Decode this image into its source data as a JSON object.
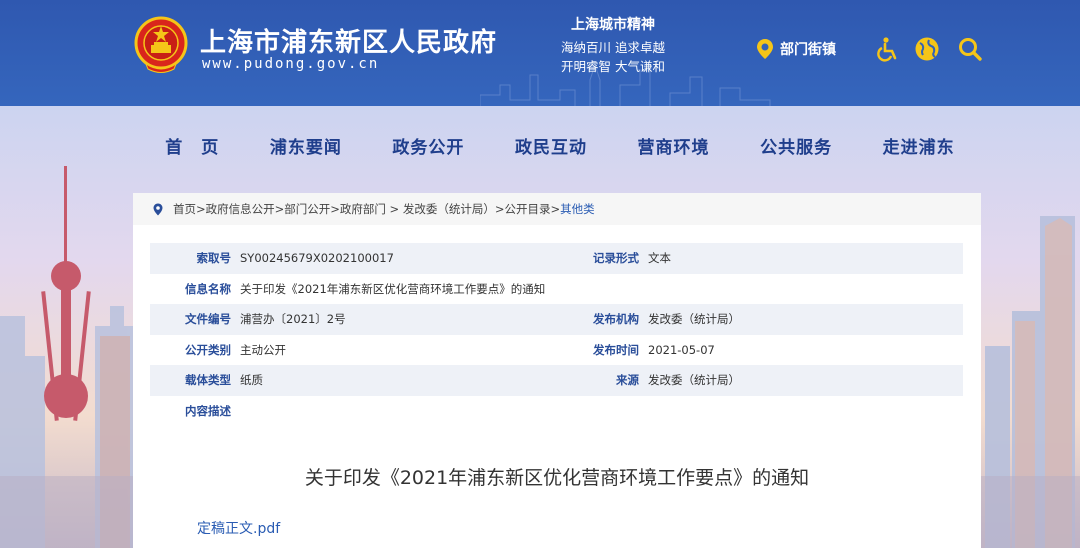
{
  "header": {
    "site_title": "上海市浦东新区人民政府",
    "site_url": "www.pudong.gov.cn",
    "spirit_title": "上海城市精神",
    "spirit_line1": "海纳百川  追求卓越",
    "spirit_line2": "开明睿智  大气谦和",
    "dept_label": "部门街镇",
    "icons": [
      "emblem",
      "location-pin-icon",
      "accessibility-icon",
      "globe-icon",
      "search-icon"
    ]
  },
  "nav": {
    "items": [
      "首　页",
      "浦东要闻",
      "政务公开",
      "政民互动",
      "营商环境",
      "公共服务",
      "走进浦东"
    ]
  },
  "breadcrumb": {
    "path": "首页>政府信息公开>部门公开>政府部门 > 发改委（统计局）>公开目录>",
    "current": "其他类"
  },
  "info": {
    "index_label": "索取号",
    "index_value": "SY00245679X0202100017",
    "format_label": "记录形式",
    "format_value": "文本",
    "name_label": "信息名称",
    "name_value": "关于印发《2021年浦东新区优化营商环境工作要点》的通知",
    "doc_no_label": "文件编号",
    "doc_no_value": "浦营办〔2021〕2号",
    "issuer_label": "发布机构",
    "issuer_value": "发改委（统计局）",
    "category_label": "公开类别",
    "category_value": "主动公开",
    "date_label": "发布时间",
    "date_value": "2021-05-07",
    "carrier_label": "载体类型",
    "carrier_value": "纸质",
    "source_label": "来源",
    "source_value": "发改委（统计局）",
    "desc_label": "内容描述",
    "desc_value": ""
  },
  "document": {
    "title": "关于印发《2021年浦东新区优化营商环境工作要点》的通知",
    "attachment": "定稿正文.pdf"
  },
  "colors": {
    "header_blue": "#3262b8",
    "nav_blue": "#1f3e8c",
    "label_blue": "#2a4e9a",
    "link_blue": "#2a5cb3",
    "accent_yellow": "#f5c518"
  }
}
